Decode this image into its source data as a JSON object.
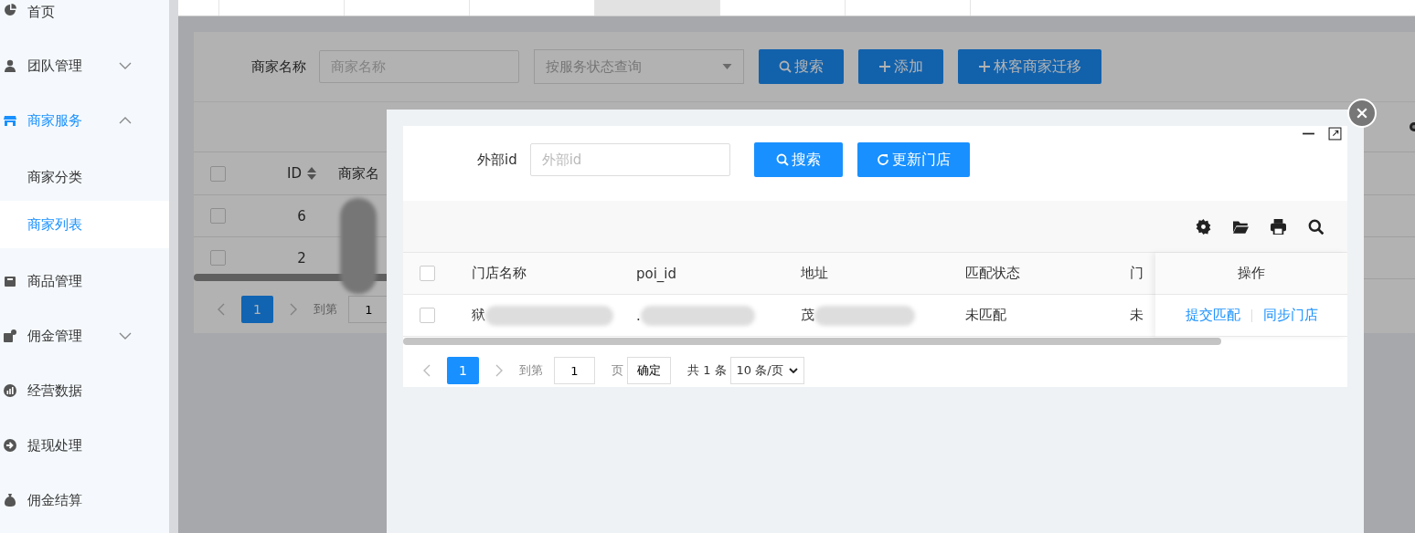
{
  "sidebar": {
    "items": [
      {
        "label": "首页",
        "selected": false
      },
      {
        "label": "团队管理",
        "selected": false,
        "expanded": false
      },
      {
        "label": "商家服务",
        "selected": false,
        "expanded": true,
        "children": [
          {
            "label": "商家分类",
            "selected": false
          },
          {
            "label": "商家列表",
            "selected": true
          }
        ]
      },
      {
        "label": "商品管理",
        "selected": false
      },
      {
        "label": "佣金管理",
        "selected": false,
        "expanded": false
      },
      {
        "label": "经营数据",
        "selected": false
      },
      {
        "label": "提现处理",
        "selected": false
      },
      {
        "label": "佣金结算",
        "selected": false
      }
    ]
  },
  "tabs": [
    {
      "selected": false
    },
    {
      "selected": false
    },
    {
      "selected": false
    },
    {
      "selected": true
    },
    {
      "selected": false
    },
    {
      "selected": false
    }
  ],
  "filter": {
    "label": "商家名称",
    "name_placeholder": "商家名称",
    "status_placeholder": "按服务状态查询",
    "buttons": [
      {
        "kind": "search",
        "label": "搜索"
      },
      {
        "kind": "add",
        "label": "添加"
      },
      {
        "kind": "add",
        "label": "林客商家迁移"
      }
    ]
  },
  "table": {
    "columns": [
      "ID",
      "商家名"
    ],
    "header_checked": false,
    "rows": [
      {
        "id": "6",
        "checked": false
      },
      {
        "id": "2",
        "checked": false
      }
    ],
    "pagination": {
      "current": "1",
      "goto_label": "到第",
      "goto_value": "1"
    }
  },
  "dialog": {
    "filter": {
      "label": "外部id",
      "placeholder": "外部id",
      "buttons": [
        {
          "kind": "search",
          "label": "搜索"
        },
        {
          "kind": "refresh",
          "label": "更新门店"
        }
      ]
    },
    "table": {
      "columns": [
        "门店名称",
        "poi_id",
        "地址",
        "匹配状态",
        "门"
      ],
      "header_checked": false,
      "action_column": "操作",
      "rows": [
        {
          "checked": false,
          "cells": [
            "狱",
            ".",
            "茂",
            "未匹配",
            "未"
          ],
          "actions": [
            "提交匹配",
            "同步门店"
          ]
        }
      ]
    },
    "pagination": {
      "current": "1",
      "goto_label": "到第",
      "goto_value": "1",
      "unit": "页",
      "confirm": "确定",
      "total": "共 1 条",
      "page_size": "10 条/页"
    }
  }
}
